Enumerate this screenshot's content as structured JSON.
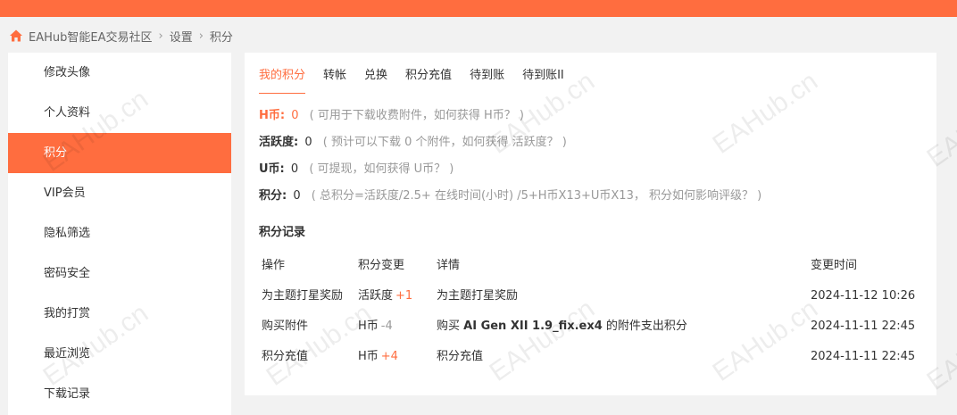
{
  "breadcrumb": {
    "site": "EAHub智能EA交易社区",
    "settings": "设置",
    "current": "积分"
  },
  "sidebar": {
    "items": [
      {
        "label": "修改头像",
        "active": false
      },
      {
        "label": "个人资料",
        "active": false
      },
      {
        "label": "积分",
        "active": true
      },
      {
        "label": "VIP会员",
        "active": false
      },
      {
        "label": "隐私筛选",
        "active": false
      },
      {
        "label": "密码安全",
        "active": false
      },
      {
        "label": "我的打赏",
        "active": false
      },
      {
        "label": "最近浏览",
        "active": false
      },
      {
        "label": "下载记录",
        "active": false
      }
    ]
  },
  "tabs": [
    "我的积分",
    "转帐",
    "兑换",
    "积分充值",
    "待到账",
    "待到账II"
  ],
  "credits": {
    "hcoin": {
      "label": "H币:",
      "value": "0",
      "note": "( 可用于下载收费附件，如何获得 H币？ )"
    },
    "activity": {
      "label": "活跃度:",
      "value": "0",
      "note": "( 预计可以下载 0 个附件，如何获得 活跃度？ )"
    },
    "ucoin": {
      "label": "U币:",
      "value": "0",
      "note": "( 可提现，如何获得 U币？ )"
    },
    "total": {
      "label": "积分:",
      "value": "0",
      "note": "( 总积分=活跃度/2.5+ 在线时间(小时) /5+H币X13+U币X13， 积分如何影响评级？ )"
    }
  },
  "records": {
    "title": "积分记录",
    "headers": [
      "操作",
      "积分变更",
      "详情",
      "变更时间"
    ],
    "rows": [
      {
        "action": "为主题打星奖励",
        "type": "活跃度",
        "delta": "+1",
        "detail_pre": "为主题打星奖励",
        "detail_bold": "",
        "detail_post": "",
        "time": "2024-11-12 10:26"
      },
      {
        "action": "购买附件",
        "type": "H币",
        "delta": "-4",
        "detail_pre": "购买 ",
        "detail_bold": "AI Gen XII 1.9_fix.ex4",
        "detail_post": " 的附件支出积分",
        "time": "2024-11-11 22:45"
      },
      {
        "action": "积分充值",
        "type": "H币",
        "delta": "+4",
        "detail_pre": "积分充值",
        "detail_bold": "",
        "detail_post": "",
        "time": "2024-11-11 22:45"
      }
    ]
  },
  "watermark": "EAHub.cn",
  "colors": {
    "accent": "#ff6d3f",
    "muted": "#999999"
  },
  "icons": {
    "home": "home-icon"
  }
}
